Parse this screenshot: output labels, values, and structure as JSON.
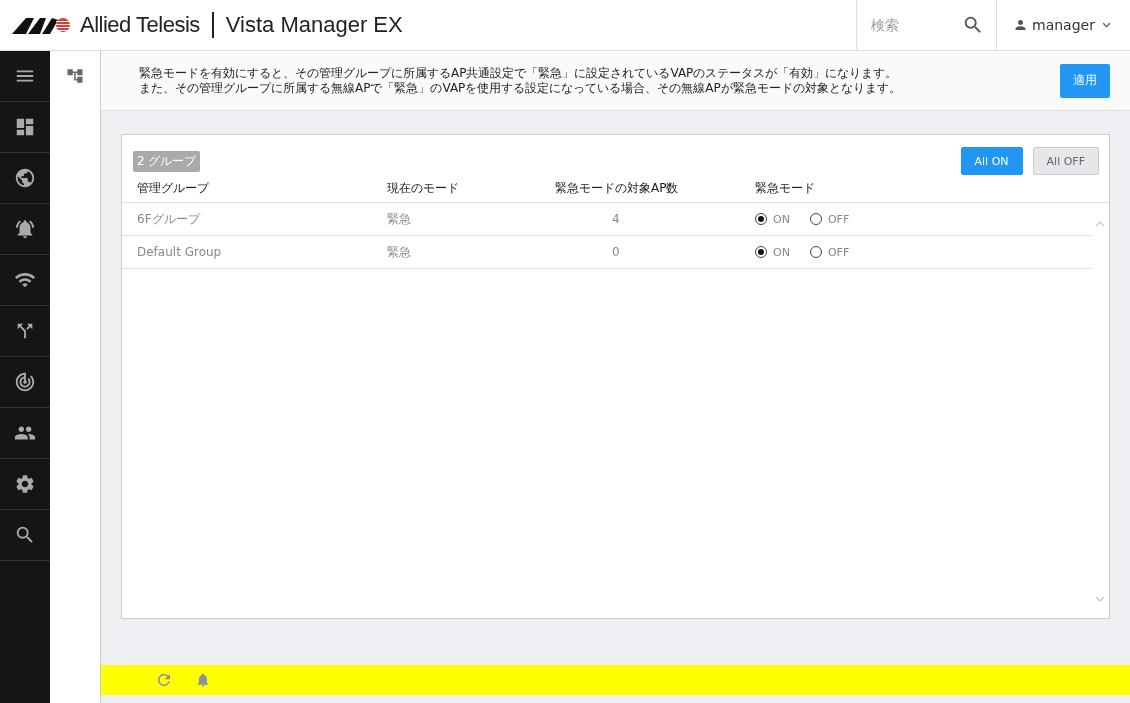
{
  "header": {
    "brand": "Allied Telesis",
    "product": "Vista Manager EX",
    "search": {
      "placeholder": "検索"
    },
    "user": "manager"
  },
  "sidebar": {
    "items": [
      {
        "kind": "menu"
      },
      {
        "kind": "dashboard"
      },
      {
        "kind": "globe"
      },
      {
        "kind": "alarm"
      },
      {
        "kind": "wifi"
      },
      {
        "kind": "topology"
      },
      {
        "kind": "radar"
      },
      {
        "kind": "users"
      },
      {
        "kind": "settings"
      },
      {
        "kind": "search"
      }
    ]
  },
  "notice": {
    "lines": [
      "緊急モードを有効にすると、その管理グループに所属するAP共通設定で「緊急」に設定されているVAPのステータスが「有効」になります。",
      "また、その管理グループに所属する無線APで「緊急」のVAPを使用する設定になっている場合、その無線APが緊急モードの対象となります。"
    ],
    "apply_button": "適用"
  },
  "table": {
    "count_badge": "2 グループ",
    "buttons": [
      {
        "label": "All ON",
        "primary": true
      },
      {
        "label": "All OFF",
        "primary": false
      }
    ],
    "columns": [
      "管理グループ",
      "現在のモード",
      "緊急モードの対象AP数",
      "緊急モード"
    ],
    "rows": [
      {
        "group": "6Fグループ",
        "current_mode": "緊急",
        "ap_count": "4",
        "options": [
          {
            "label": "ON",
            "selected": true
          },
          {
            "label": "OFF",
            "selected": false
          }
        ]
      },
      {
        "group": "Default Group",
        "current_mode": "緊急",
        "ap_count": "0",
        "options": [
          {
            "label": "ON",
            "selected": true
          },
          {
            "label": "OFF",
            "selected": false
          }
        ]
      }
    ]
  }
}
